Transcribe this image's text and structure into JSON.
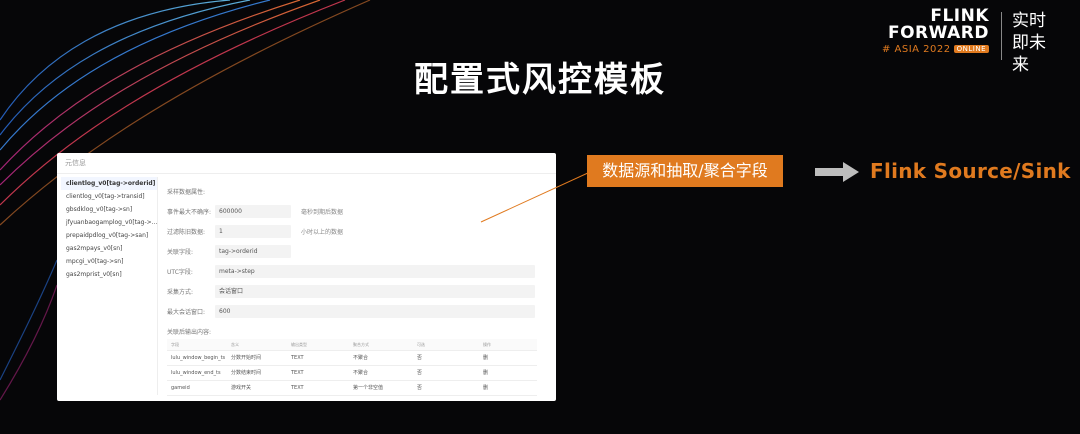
{
  "slide": {
    "title": "配置式风控模板",
    "callout": "数据源和抽取/聚合字段",
    "target": "Flink Source/Sink"
  },
  "brand": {
    "line1": "FLINK",
    "line2": "FORWARD",
    "line3": "# ASIA 2022",
    "online": "ONLINE",
    "slogan": "实时即未来"
  },
  "screenshot": {
    "header": "元信息",
    "sidebar": [
      {
        "label": "clientlog_v0[tag->orderid]",
        "badge": "✓"
      },
      {
        "label": "clientlog_v0[tag->transid]"
      },
      {
        "label": "gbsdklog_v0[tag->sn]"
      },
      {
        "label": "jfyuanbaogamplog_v0[tag->..."
      },
      {
        "label": "prepaidpdlog_v0[tag->san]"
      },
      {
        "label": "gas2mpays_v0[sn]"
      },
      {
        "label": "mpcgi_v0[tag->sn]"
      },
      {
        "label": "gas2mprist_v0[sn]"
      }
    ],
    "form": [
      {
        "label": "采样数据属性:",
        "value": "",
        "note": ""
      },
      {
        "label": "事件最大不确序:",
        "value": "600000",
        "note": "毫秒到期后数据"
      },
      {
        "label": "过滤陈旧数据:",
        "value": "1",
        "note": "小时以上的数据"
      },
      {
        "label": "关联字段:",
        "value": "tag->orderid",
        "note": ""
      },
      {
        "label": "UTC字段:",
        "value": "meta->step",
        "note": ""
      },
      {
        "label": "采集方式:",
        "value": "会话窗口",
        "note": ""
      },
      {
        "label": "最大会话窗口:",
        "value": "600",
        "note": ""
      },
      {
        "label": "关联后输出内容:",
        "value": "",
        "note": ""
      }
    ],
    "table": {
      "headers": [
        "字段",
        "含义",
        "输出类型",
        "聚合方式",
        "可选",
        "操作"
      ],
      "rows": [
        [
          "lulu_window_begin_ts",
          "分数开始时间",
          "TEXT",
          "不聚合",
          "否",
          "删"
        ],
        [
          "lulu_window_end_ts",
          "分数结束时间",
          "TEXT",
          "不聚合",
          "否",
          "删"
        ],
        [
          "gameid",
          "游戏开关",
          "TEXT",
          "第一个非空值",
          "否",
          "删"
        ]
      ]
    }
  },
  "colors": {
    "accent": "#e07a1f",
    "background": "#060608"
  }
}
